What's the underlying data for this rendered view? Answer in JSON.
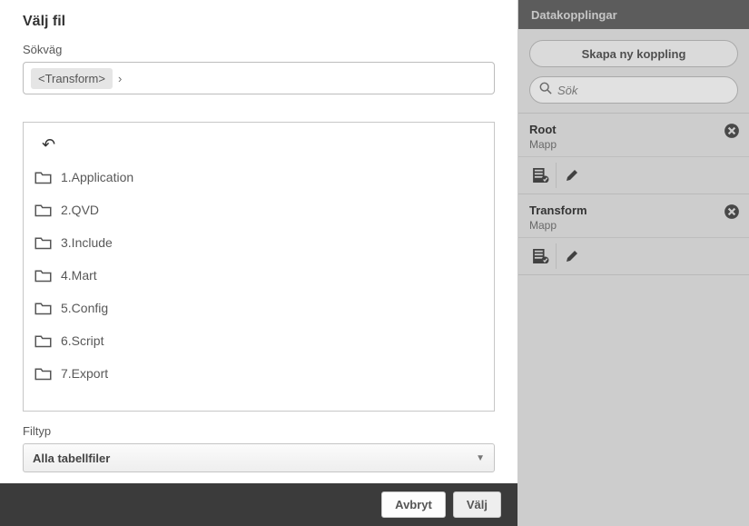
{
  "dialog": {
    "title": "Välj fil",
    "path_label": "Sökväg",
    "path_chip": "<Transform>",
    "path_separator": "›",
    "files": [
      "1.Application",
      "2.QVD",
      "3.Include",
      "4.Mart",
      "5.Config",
      "6.Script",
      "7.Export"
    ],
    "filetype_label": "Filtyp",
    "filetype_value": "Alla tabellfiler",
    "cancel": "Avbryt",
    "select": "Välj"
  },
  "side": {
    "header": "Datakopplingar",
    "new_conn": "Skapa ny koppling",
    "search_placeholder": "Sök",
    "connections": [
      {
        "name": "Root",
        "type": "Mapp"
      },
      {
        "name": "Transform",
        "type": "Mapp"
      }
    ]
  }
}
